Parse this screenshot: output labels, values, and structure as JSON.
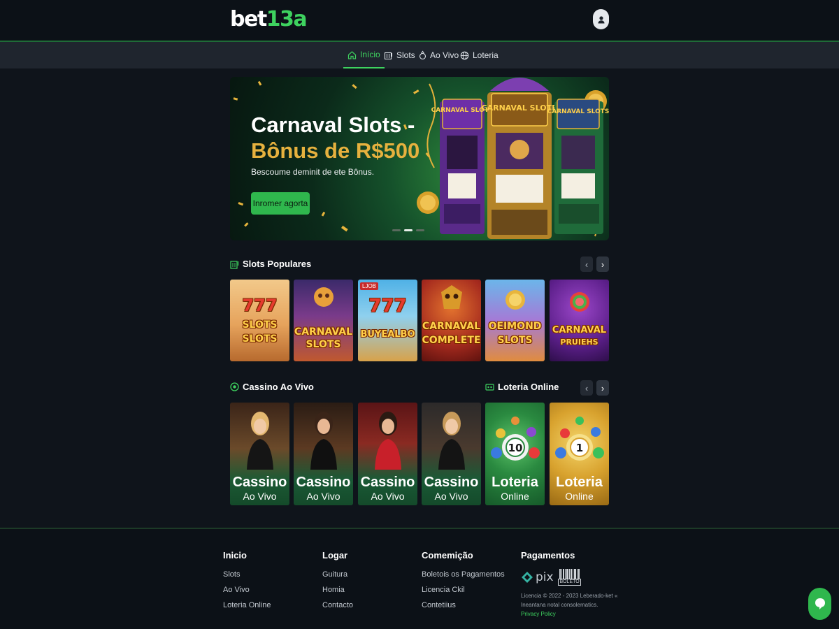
{
  "header": {
    "logo_main": "bet",
    "logo_accent": "13a"
  },
  "nav": {
    "items": [
      {
        "label": "Início",
        "icon": "home-icon",
        "active": true
      },
      {
        "label": "Slots",
        "icon": "slot-machine-icon",
        "active": false
      },
      {
        "label": "Ao Vivo",
        "icon": "chip-icon",
        "active": false
      },
      {
        "label": "Loteria",
        "icon": "globe-icon",
        "active": false
      }
    ]
  },
  "hero": {
    "title_line1": "Carnaval Slots -",
    "title_line2": "Bônus de R$500",
    "subtitle": "Bescoume deminit de ete Bônus.",
    "cta": "Inromer agorta",
    "machine_labels": [
      "CARNAVAL SLOTS",
      "CARNAVAL SLOTB",
      "CARNAVAL SLOTS"
    ]
  },
  "slots_section": {
    "title": "Slots Populares",
    "games": [
      {
        "line1": "777",
        "line2": "SLOTS",
        "line3": "SLOTS"
      },
      {
        "line1": "",
        "line2": "CARNAVAL",
        "line3": "SLOTS"
      },
      {
        "line1": "777",
        "line2": "BUYEALBO",
        "line3": "",
        "badge": "LJOB"
      },
      {
        "line1": "",
        "line2": "CARNAVAL",
        "line3": "COMPLETE"
      },
      {
        "line1": "",
        "line2": "OEIMOND",
        "line3": "SLOTS"
      },
      {
        "line1": "",
        "line2": "CARNAVAL",
        "line3": "PRUIEHS"
      }
    ]
  },
  "live_section": {
    "title": "Cassino Ao Vivo"
  },
  "lottery_section": {
    "title": "Loteria Online"
  },
  "live_cards": [
    {
      "t1": "Cassino",
      "t2": "Ao Vivo"
    },
    {
      "t1": "Cassino",
      "t2": "Ao Vivo"
    },
    {
      "t1": "Cassino",
      "t2": "Ao Vivo"
    },
    {
      "t1": "Cassino",
      "t2": "Ao Vivo"
    },
    {
      "t1": "Loteria",
      "t2": "Online",
      "ball": "10"
    },
    {
      "t1": "Loteria",
      "t2": "Online",
      "ball": "1"
    }
  ],
  "footer": {
    "col1": {
      "head": "Inicio",
      "links": [
        "Slots",
        "Ao Vivo",
        "Loteria Online"
      ]
    },
    "col2": {
      "head": "Logar",
      "links": [
        "Guitura",
        "Homia",
        "Contacto"
      ]
    },
    "col3": {
      "head": "Comemição",
      "links": [
        "Boletois os Pagamentos",
        "Licencia Ckil",
        "Contetiius"
      ]
    },
    "col4": {
      "head": "Pagamentos",
      "pix": "pix",
      "boleto": "BOLETO",
      "legal_line1": "Licencia © 2022 - 2023 Leberado-ket «",
      "legal_line2": "Ineantana notal consolematics.",
      "privacy": "Privacy Policy"
    }
  },
  "colors": {
    "accent": "#3ed25f",
    "background": "#0f141b",
    "nav": "#1f252e",
    "gold": "#e6b13e"
  }
}
